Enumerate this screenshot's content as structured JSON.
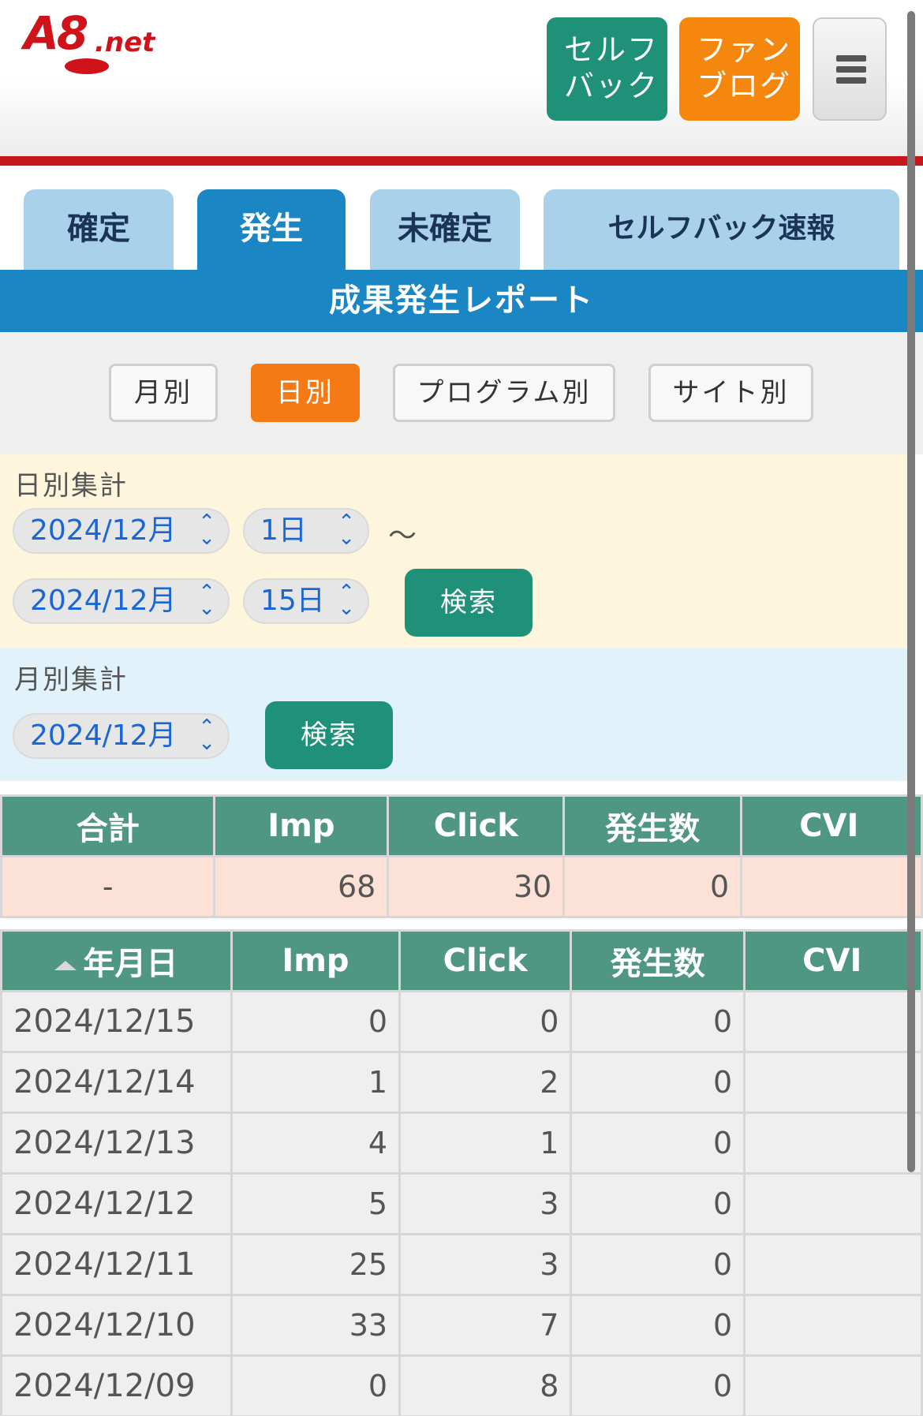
{
  "header": {
    "logo": "A8.net",
    "selfback_label_1": "セルフ",
    "selfback_label_2": "バック",
    "fanblog_label_1": "ファン",
    "fanblog_label_2": "ブログ",
    "menu_icon": "hamburger-menu-icon"
  },
  "tabs": [
    {
      "label": "確定"
    },
    {
      "label": "発生"
    },
    {
      "label": "未確定"
    },
    {
      "label": "セルフバック速報"
    }
  ],
  "report_title": "成果発生レポート",
  "subtabs": [
    {
      "label": "月別"
    },
    {
      "label": "日別"
    },
    {
      "label": "プログラム別"
    },
    {
      "label": "サイト別"
    }
  ],
  "daily": {
    "title": "日別集計",
    "from_month": "2024/12月",
    "from_day": "1日",
    "tilde": "〜",
    "to_month": "2024/12月",
    "to_day": "15日",
    "search_label": "検索"
  },
  "monthly": {
    "title": "月別集計",
    "month": "2024/12月",
    "search_label": "検索"
  },
  "summary_table": {
    "headers": [
      "合計",
      "Imp",
      "Click",
      "発生数",
      "CVI"
    ],
    "row": [
      "-",
      "68",
      "30",
      "0",
      ""
    ]
  },
  "daily_table": {
    "headers": [
      "年月日",
      "Imp",
      "Click",
      "発生数",
      "CVI"
    ],
    "rows": [
      [
        "2024/12/15",
        "0",
        "0",
        "0",
        ""
      ],
      [
        "2024/12/14",
        "1",
        "2",
        "0",
        ""
      ],
      [
        "2024/12/13",
        "4",
        "1",
        "0",
        ""
      ],
      [
        "2024/12/12",
        "5",
        "3",
        "0",
        ""
      ],
      [
        "2024/12/11",
        "25",
        "3",
        "0",
        ""
      ],
      [
        "2024/12/10",
        "33",
        "7",
        "0",
        ""
      ],
      [
        "2024/12/09",
        "0",
        "8",
        "0",
        ""
      ]
    ]
  },
  "colors": {
    "brand_red": "#c8161d",
    "tab_blue": "#1a86c4",
    "tab_light": "#a9d2ea",
    "orange": "#f57a14",
    "green": "#1f9178",
    "table_header": "#4f9683"
  }
}
